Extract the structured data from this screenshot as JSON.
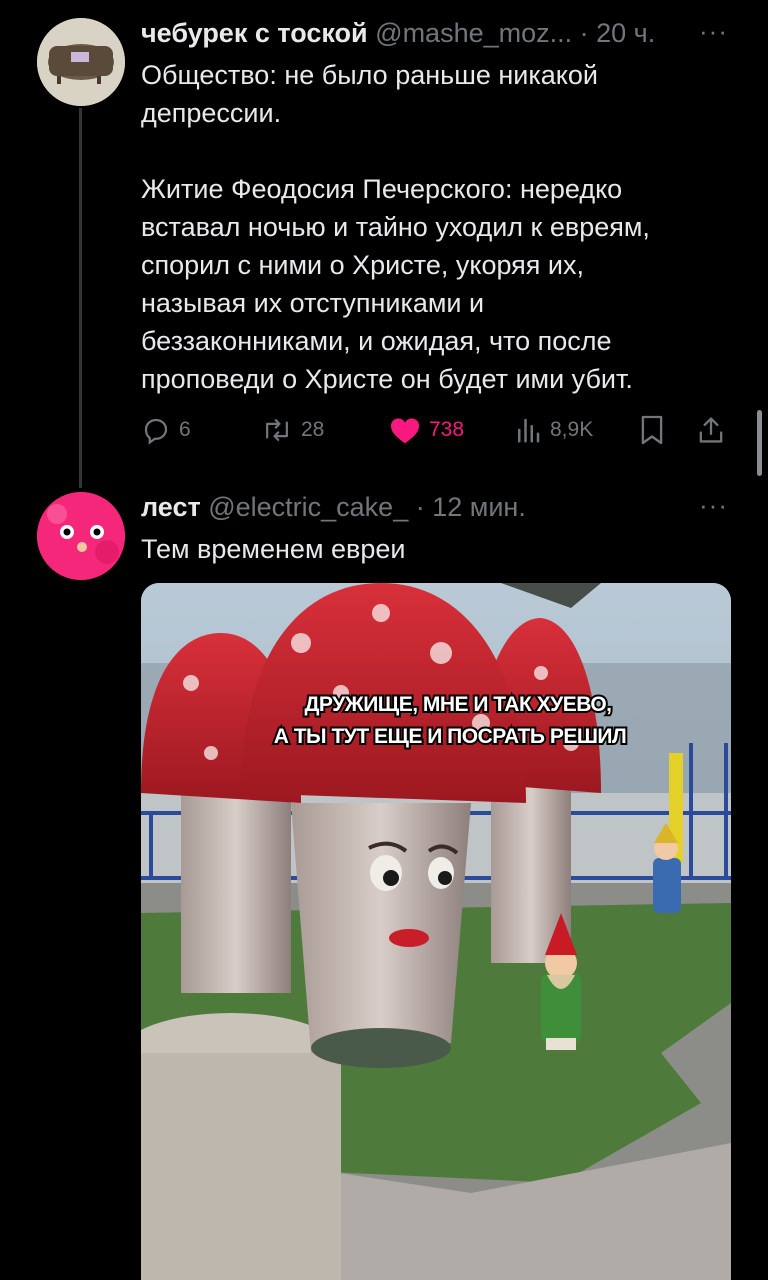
{
  "tweets": [
    {
      "author": "чебурек с тоской",
      "handle": "@mashe_moz...",
      "time": "· 20 ч.",
      "text": "Общество: не было раньше никакой\nдепрессии.\n\nЖитие Феодосия Печерского: нередко\nвставал ночью и тайно уходил к евреям,\nспорил с ними о Христе, укоряя их,\nназывая их отступниками и\nбеззаконниками, и ожидая, что после\nпроповеди о Христе он будет ими убит.",
      "replies": "6",
      "retweets": "28",
      "likes": "738",
      "views": "8,9K",
      "liked": true
    },
    {
      "author": "лест",
      "handle": "@electric_cake_",
      "time": "· 12 мин.",
      "text": "Тем временем евреи",
      "meme_caption_line1": "ДРУЖИЩЕ, МНЕ И ТАК ХУЕВО,",
      "meme_caption_line2": "А ТЫ ТУТ ЕЩЕ И ПОСРАТЬ РЕШИЛ"
    }
  ],
  "more_label": "···",
  "colors": {
    "like": "#f91880",
    "muted": "#71767b",
    "text": "#e7e9ea"
  },
  "icons": [
    "reply-icon",
    "retweet-icon",
    "heart-icon",
    "views-icon",
    "bookmark-icon",
    "share-icon",
    "more-icon"
  ]
}
